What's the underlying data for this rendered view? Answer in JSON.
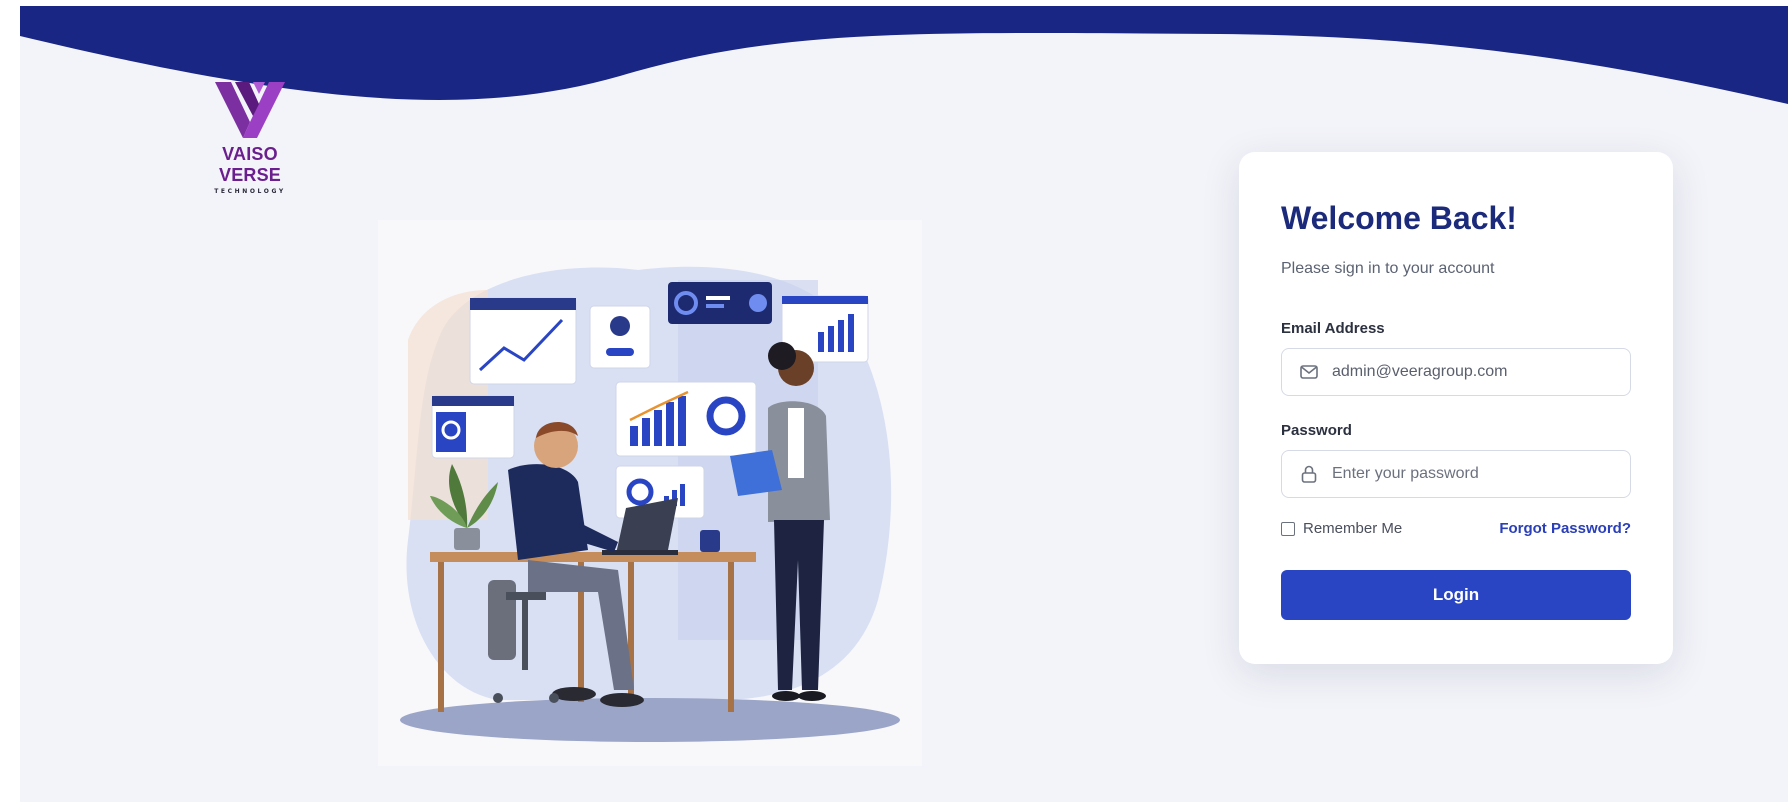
{
  "brand": {
    "name": "VAISO VERSE",
    "tagline": "TECHNOLOGY",
    "logo_icon": "vv-logo-icon",
    "colors": {
      "wave": "#1a2683",
      "logo": "#6b1f8f",
      "accent": "#2a45c4"
    }
  },
  "illustration": {
    "icon": "office-workers-illustration"
  },
  "login_card": {
    "title": "Welcome Back!",
    "subtitle": "Please sign in to your account",
    "email_label": "Email Address",
    "email_value": "admin@veeragroup.com",
    "email_icon": "mail-icon",
    "password_label": "Password",
    "password_placeholder": "Enter your password",
    "password_icon": "lock-icon",
    "remember_label": "Remember Me",
    "remember_checked": false,
    "forgot_label": "Forgot Password?",
    "login_label": "Login"
  }
}
